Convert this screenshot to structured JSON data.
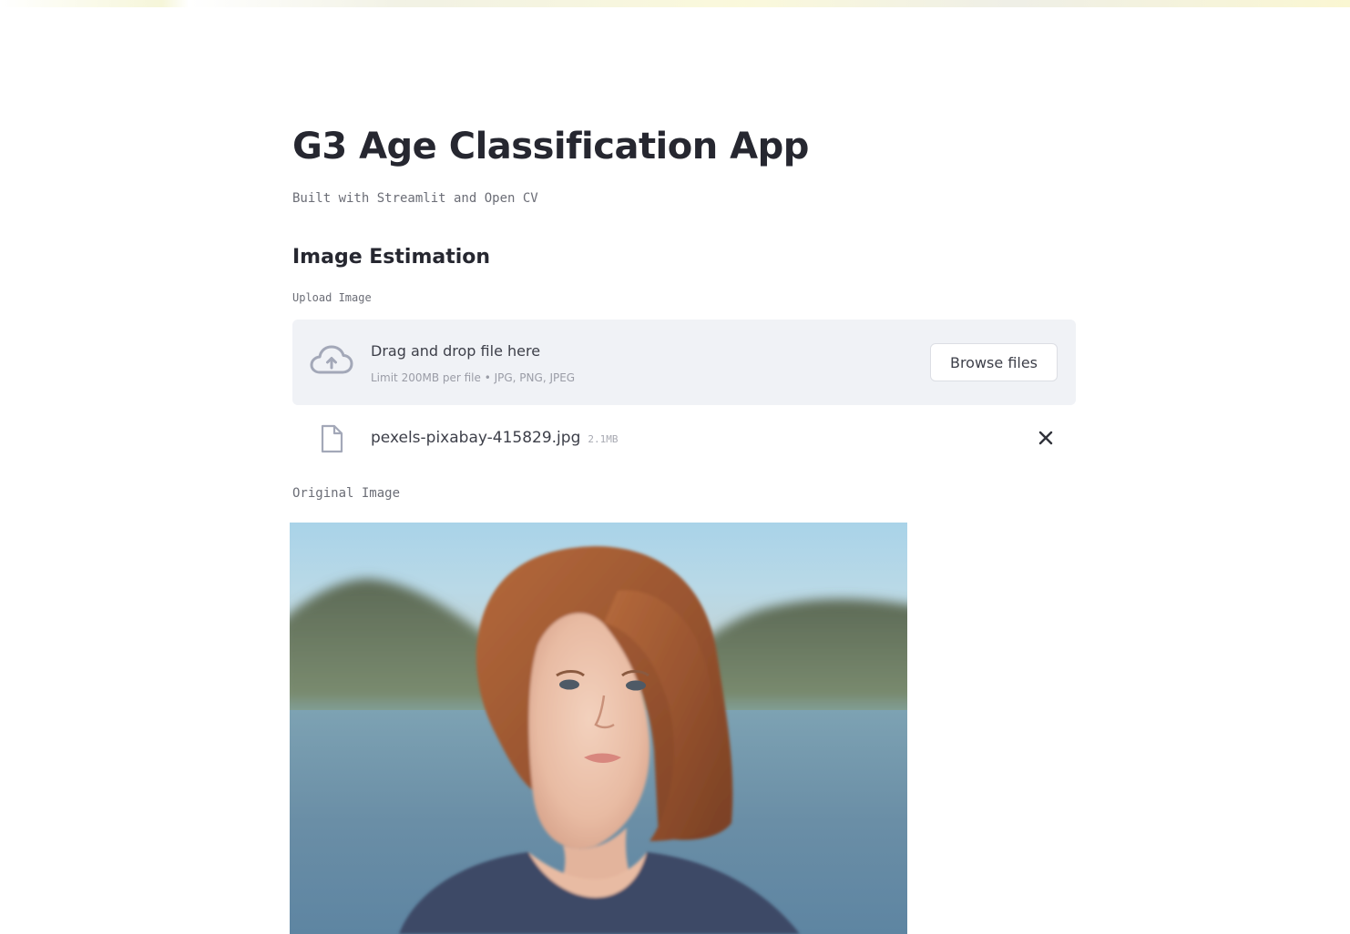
{
  "app": {
    "title": "G3 Age Classification App",
    "subtitle": "Built with Streamlit and Open CV"
  },
  "section": {
    "heading": "Image Estimation"
  },
  "uploader": {
    "label": "Upload Image",
    "drag_text": "Drag and drop file here",
    "limit_text": "Limit 200MB per file • JPG, PNG, JPEG",
    "browse_label": "Browse files",
    "upload_icon": "cloud-upload-icon"
  },
  "uploaded_file": {
    "name": "pexels-pixabay-415829.jpg",
    "size": "2.1MB",
    "file_icon": "file-icon",
    "remove_icon": "close-icon"
  },
  "image_caption": "Original Image",
  "colors": {
    "background": "#ffffff",
    "dropzone_bg": "#f0f2f6",
    "text": "#262730",
    "muted": "#6b6d76",
    "icon": "#a3a8b8"
  }
}
